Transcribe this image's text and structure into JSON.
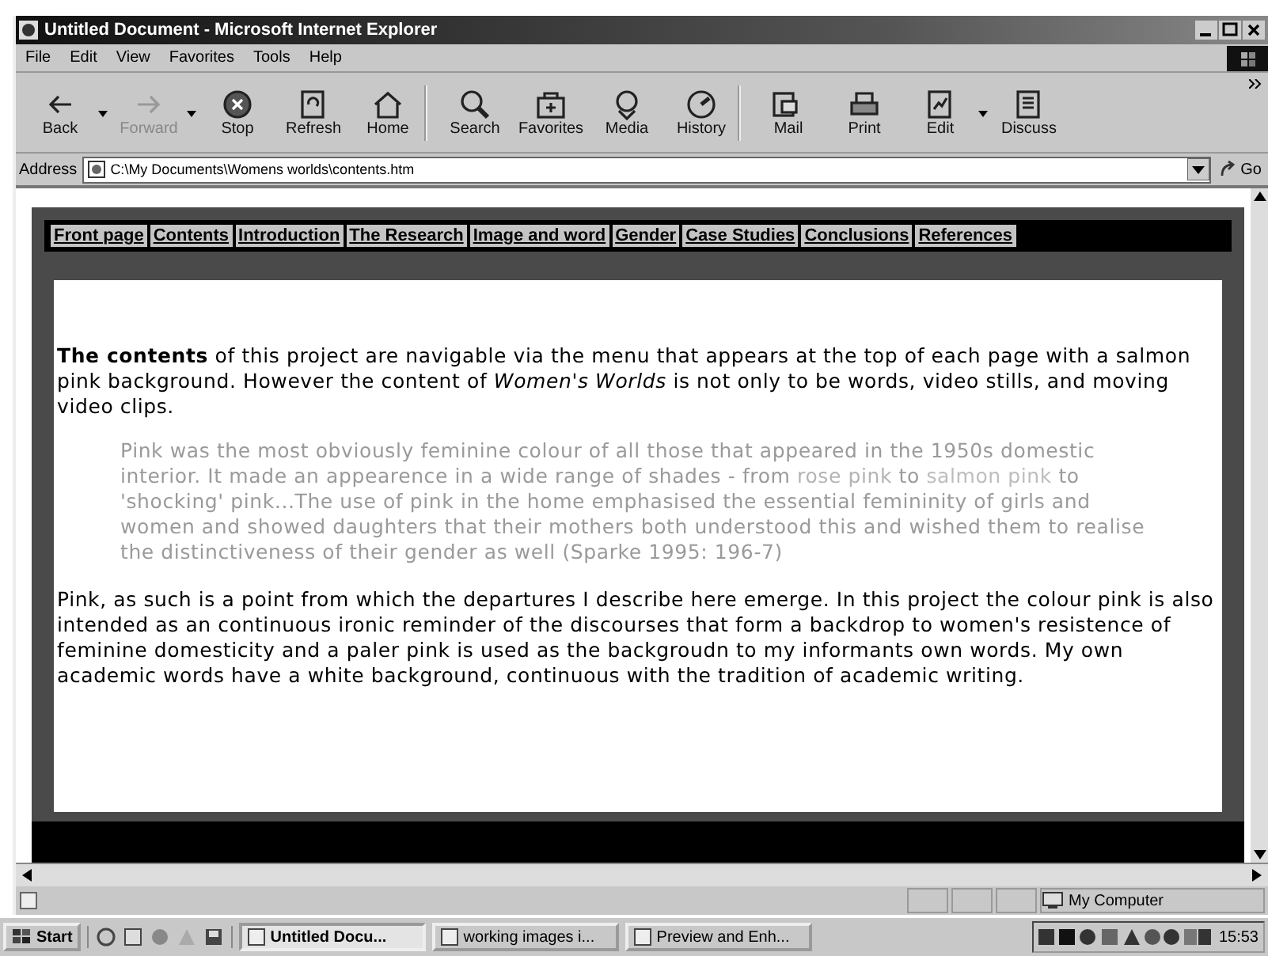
{
  "window": {
    "title": "Untitled Document - Microsoft Internet Explorer"
  },
  "menu": [
    "File",
    "Edit",
    "View",
    "Favorites",
    "Tools",
    "Help"
  ],
  "toolbar": [
    {
      "label": "Back",
      "disabled": false,
      "dropdown": true
    },
    {
      "label": "Forward",
      "disabled": true,
      "dropdown": true
    },
    {
      "label": "Stop",
      "disabled": false,
      "dropdown": false
    },
    {
      "label": "Refresh",
      "disabled": false,
      "dropdown": false
    },
    {
      "label": "Home",
      "disabled": false,
      "dropdown": false,
      "separator_after": true
    },
    {
      "label": "Search",
      "disabled": false,
      "dropdown": false
    },
    {
      "label": "Favorites",
      "disabled": false,
      "dropdown": false
    },
    {
      "label": "Media",
      "disabled": false,
      "dropdown": false
    },
    {
      "label": "History",
      "disabled": false,
      "dropdown": false,
      "separator_after": true
    },
    {
      "label": "Mail",
      "disabled": false,
      "dropdown": false
    },
    {
      "label": "Print",
      "disabled": false,
      "dropdown": false
    },
    {
      "label": "Edit",
      "disabled": false,
      "dropdown": true
    },
    {
      "label": "Discuss",
      "disabled": false,
      "dropdown": false
    }
  ],
  "address": {
    "label": "Address",
    "value": "C:\\My Documents\\Womens worlds\\contents.htm",
    "go": "Go"
  },
  "nav": [
    "Front page",
    "Contents",
    "Introduction",
    "The Research",
    "Image and word",
    "Gender",
    "Case Studies",
    "Conclusions",
    "References"
  ],
  "content": {
    "intro": "**The contents** of this project are navigable via the menu that appears at the top of each page with a salmon pink background. However the content of *Women's Worlds* is not only to be words, video stills, and moving video clips.",
    "quote": [
      {
        "text": "Pink was the most obviously feminine colour of all those that appeared in the 1950s domestic interior. It made an appearence in a wide range of shades - from ",
        "color": "#9a9a9a"
      },
      {
        "text": "rose pink",
        "color": "#b4b4b4"
      },
      {
        "text": " to ",
        "color": "#9a9a9a"
      },
      {
        "text": "salmon pink",
        "color": "#bdbdbd"
      },
      {
        "text": " to 'shocking' pink...The use of pink in the home emphasised the essential femininity of girls and women and showed daughters that their mothers both understood this and wished them to realise the distinctiveness of their gender as well (Sparke 1995: 196-7)",
        "color": "#9a9a9a"
      }
    ],
    "closing": "Pink, as such is a point from which the departures I describe here emerge. In this project the colour pink is also intended as an continuous ironic reminder of the discourses that form a backdrop to women's resistence of feminine domesticity and a paler pink is used as the backgroudn to my informants own words. My own academic words have a white background, continuous with the tradition of academic writing."
  },
  "status_bar": {
    "zone": "My Computer"
  },
  "taskbar": {
    "start": "Start",
    "tasks": [
      {
        "label": "Untitled Docu...",
        "selected": true
      },
      {
        "label": "working images i...",
        "selected": false
      },
      {
        "label": "Preview and Enh...",
        "selected": false
      }
    ],
    "clock": "15:53"
  }
}
